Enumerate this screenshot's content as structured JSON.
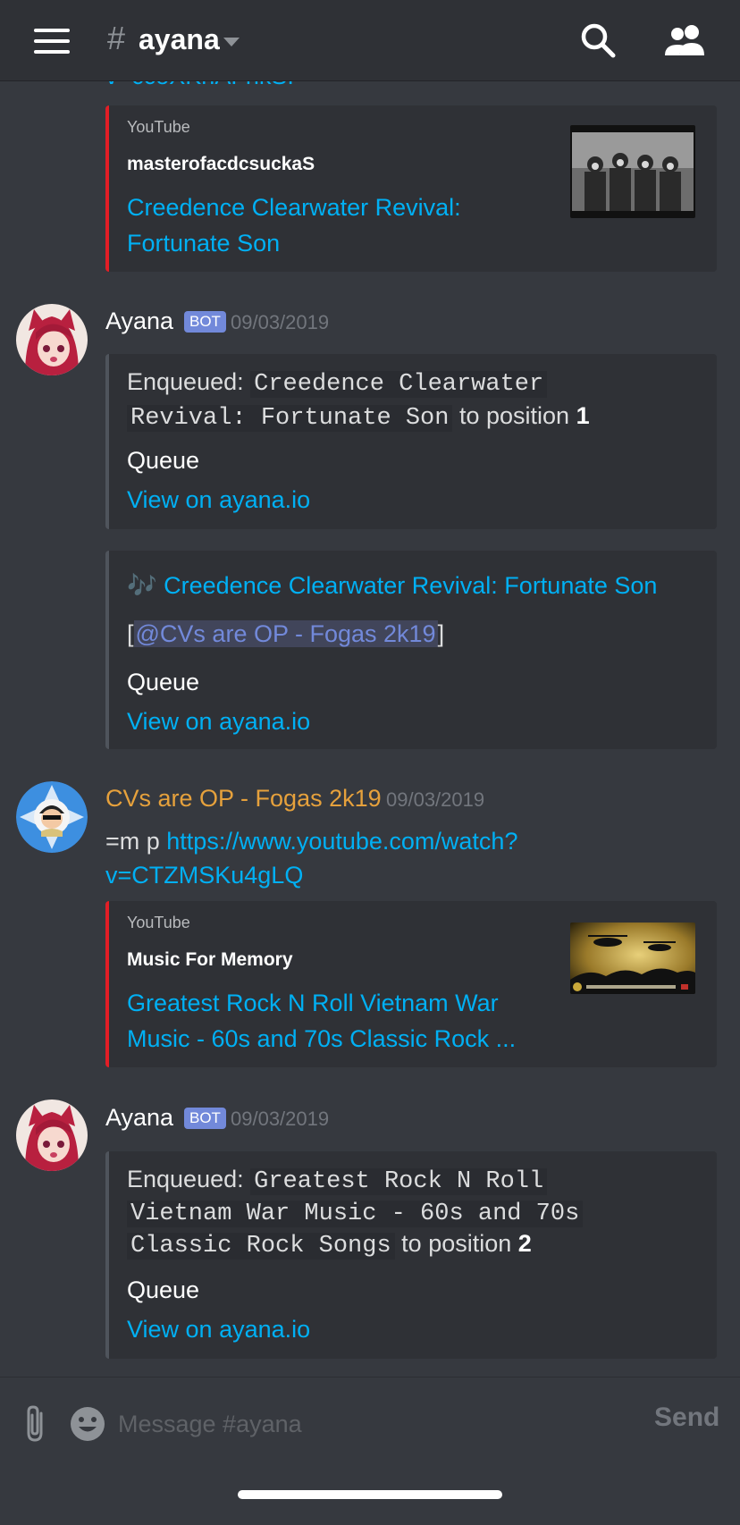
{
  "header": {
    "hash": "#",
    "channel": "ayana"
  },
  "messages": {
    "cut_link": "v=ccoXKnAFnkSI",
    "embed1": {
      "provider": "YouTube",
      "author": "masterofacdcsuckaS",
      "title_line1": "Creedence Clearwater Revival:",
      "title_line2": "Fortunate Son"
    },
    "msg1": {
      "username": "Ayana",
      "bot_tag": "BOT",
      "timestamp": "09/03/2019",
      "embed_a": {
        "enqueued": "Enqueued:",
        "code_line1": "Creedence Clearwater",
        "code_line2": "Revival: Fortunate Son",
        "to_position": "to position",
        "position": "1",
        "queue": "Queue",
        "view_link": "View on ayana.io"
      },
      "embed_b": {
        "music_emoji": "🎶",
        "song": "Creedence Clearwater Revival: Fortunate Son",
        "bracket_open": "[",
        "mention": "@CVs are OP - Fogas 2k19",
        "bracket_close": "]",
        "queue": "Queue",
        "view_link": "View on ayana.io"
      }
    },
    "msg2": {
      "username": "CVs are OP - Fogas 2k19",
      "username_color": "#e6a13c",
      "timestamp": "09/03/2019",
      "command": "=m p ",
      "link_line1": "https://www.youtube.com/watch?",
      "link_line2": "v=CTZMSKu4gLQ",
      "embed": {
        "provider": "YouTube",
        "author": "Music For Memory",
        "title_line1": "Greatest Rock N Roll Vietnam War",
        "title_line2": "Music - 60s and 70s Classic Rock ..."
      }
    },
    "msg3": {
      "username": "Ayana",
      "bot_tag": "BOT",
      "timestamp": "09/03/2019",
      "embed": {
        "enqueued": "Enqueued:",
        "code_line1": "Greatest Rock N Roll",
        "code_line2": "Vietnam War Music - 60s and 70s",
        "code_line3": "Classic Rock Songs",
        "to_position": "to position",
        "position": "2",
        "queue": "Queue",
        "view_link": "View on ayana.io"
      }
    }
  },
  "input": {
    "placeholder": "Message #ayana",
    "send_label": "Send"
  },
  "colors": {
    "background": "#36393f",
    "embed_bg": "#2f3136",
    "link": "#00b0f4",
    "youtube_red": "#e21e26",
    "bot_tag": "#7289da"
  },
  "icons": [
    "hamburger-icon",
    "search-icon",
    "members-icon",
    "attach-icon",
    "emoji-icon"
  ]
}
